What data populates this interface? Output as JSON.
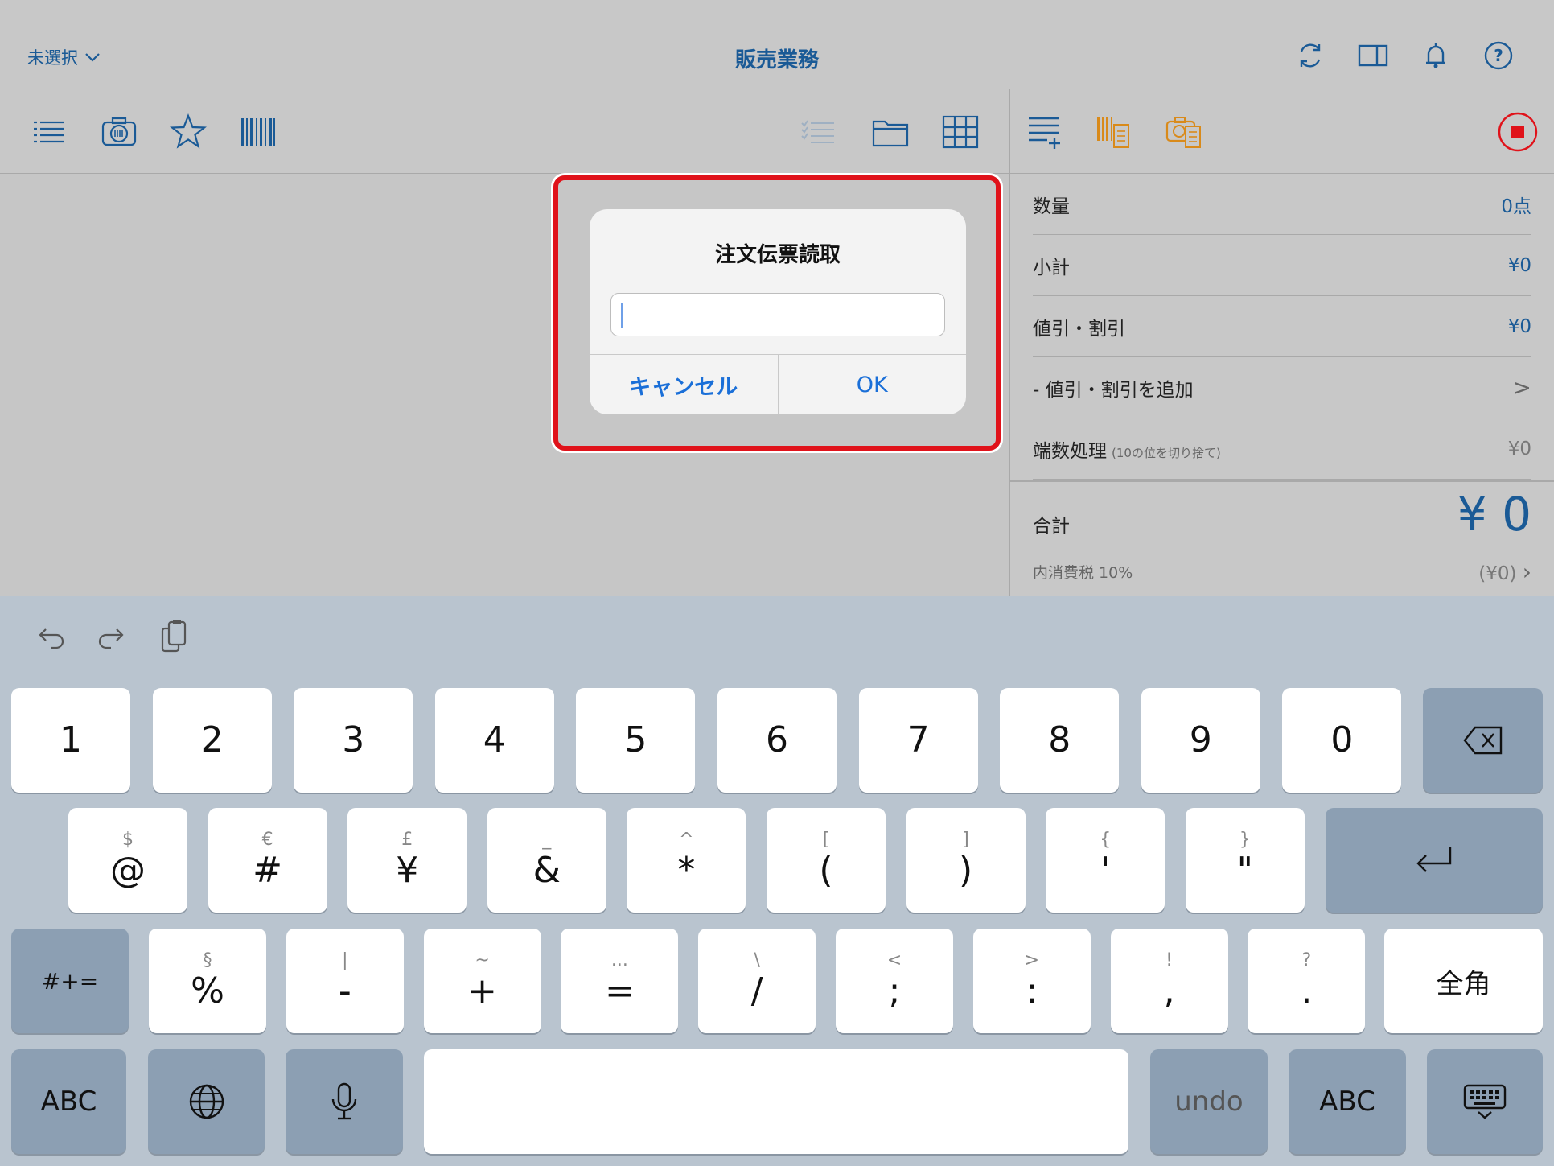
{
  "nav": {
    "selector_label": "未選択",
    "title": "販売業務",
    "icons": [
      "refresh-icon",
      "split-view-icon",
      "bell-icon",
      "help-icon"
    ]
  },
  "toolbar": {
    "left_icons": [
      "list-icon",
      "camera-icon",
      "star-icon",
      "barcode-icon"
    ],
    "right_icons": [
      "checklist-icon",
      "folder-icon",
      "grid-icon"
    ]
  },
  "panel": {
    "icons": [
      "add-list-icon",
      "barcode-receipt-icon",
      "camera-receipt-icon",
      "stop-icon"
    ]
  },
  "summary": {
    "rows": [
      {
        "label": "数量",
        "value": "0点"
      },
      {
        "label": "小計",
        "value": "¥0"
      },
      {
        "label": "値引・割引",
        "value": "¥0"
      },
      {
        "label": "- 値引・割引を追加",
        "value": ">"
      },
      {
        "label": "端数処理",
        "sub": "(10の位を切り捨て)",
        "value": "¥0"
      }
    ],
    "total_label": "合計",
    "total_value": "¥ 0",
    "tax_label": "内消費税 10%",
    "tax_value": "(¥0)"
  },
  "alert": {
    "title": "注文伝票読取",
    "input_value": "",
    "cancel_label": "キャンセル",
    "ok_label": "OK"
  },
  "keyboard": {
    "row1": [
      "1",
      "2",
      "3",
      "4",
      "5",
      "6",
      "7",
      "8",
      "9",
      "0"
    ],
    "row2": [
      {
        "alt": "$",
        "main": "@"
      },
      {
        "alt": "€",
        "main": "#"
      },
      {
        "alt": "£",
        "main": "¥"
      },
      {
        "alt": "_",
        "main": "&"
      },
      {
        "alt": "^",
        "main": "*"
      },
      {
        "alt": "[",
        "main": "("
      },
      {
        "alt": "]",
        "main": ")"
      },
      {
        "alt": "{",
        "main": "'"
      },
      {
        "alt": "}",
        "main": "\""
      }
    ],
    "row3": [
      {
        "alt": "§",
        "main": "%"
      },
      {
        "alt": "|",
        "main": "-"
      },
      {
        "alt": "~",
        "main": "+"
      },
      {
        "alt": "...",
        "main": "="
      },
      {
        "alt": "\\",
        "main": "/"
      },
      {
        "alt": "<",
        "main": ";"
      },
      {
        "alt": ">",
        "main": ":"
      },
      {
        "alt": "!",
        "main": ","
      },
      {
        "alt": "?",
        "main": "."
      }
    ],
    "symbols_label": "#+=",
    "zenkaku_label": "全角",
    "abc_left": "ABC",
    "undo_label": "undo",
    "abc_right": "ABC"
  },
  "colors": {
    "accent": "#1a5a96",
    "highlight": "#e0121a",
    "link": "#1a6fd8",
    "orange": "#d98a1a"
  }
}
